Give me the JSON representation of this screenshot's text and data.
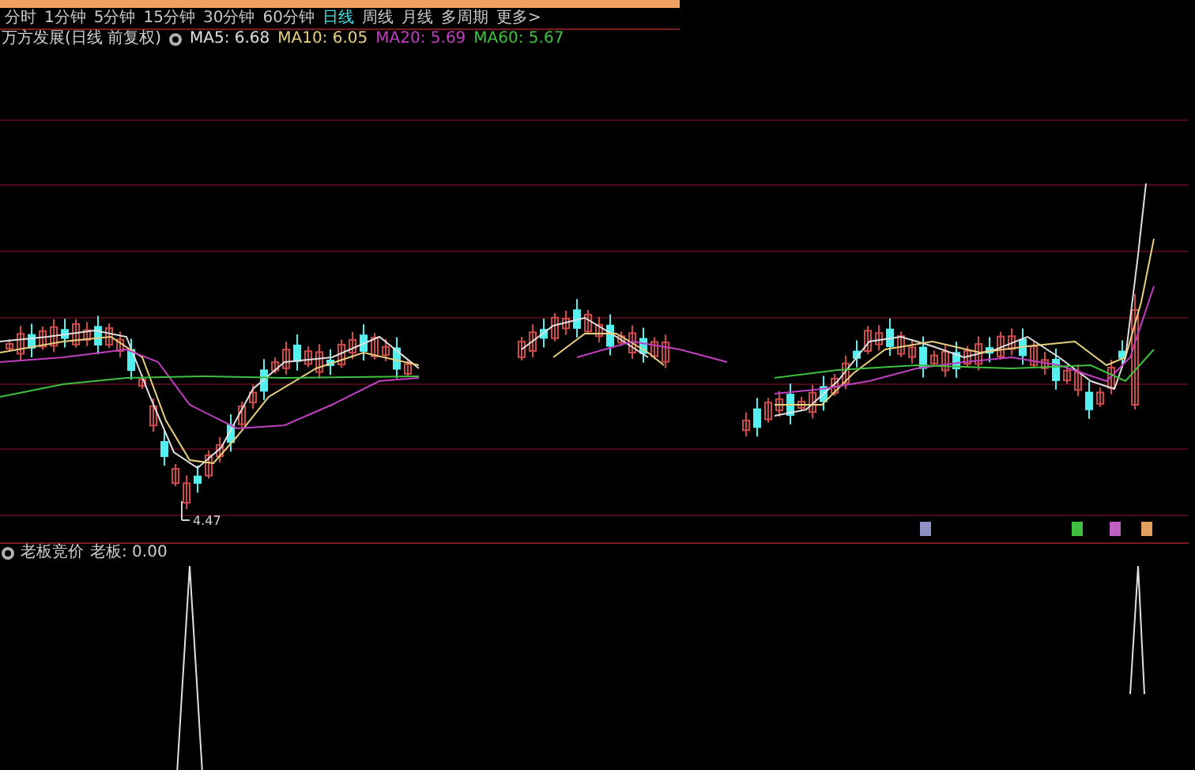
{
  "period_tabs": [
    {
      "label": "分时",
      "selected": false
    },
    {
      "label": "1分钟",
      "selected": false
    },
    {
      "label": "5分钟",
      "selected": false
    },
    {
      "label": "15分钟",
      "selected": false
    },
    {
      "label": "30分钟",
      "selected": false
    },
    {
      "label": "60分钟",
      "selected": false
    },
    {
      "label": "日线",
      "selected": true
    },
    {
      "label": "周线",
      "selected": false
    },
    {
      "label": "月线",
      "selected": false
    },
    {
      "label": "多周期",
      "selected": false
    },
    {
      "label": "更多>",
      "selected": false
    }
  ],
  "legend": {
    "title": "万方发展(日线 前复权)",
    "averages": [
      {
        "label": "MA5: 6.68",
        "color": "#e0e0e0"
      },
      {
        "label": "MA10: 6.05",
        "color": "#e8d080"
      },
      {
        "label": "MA20: 5.69",
        "color": "#c040c0"
      },
      {
        "label": "MA60: 5.67",
        "color": "#40c040"
      }
    ]
  },
  "price_chart": {
    "low_label": "4.47",
    "event_markers": [
      {
        "color": "#9090c8"
      },
      {
        "color": "#40c040"
      },
      {
        "color": "#c060c0"
      },
      {
        "color": "#e0a060"
      }
    ]
  },
  "indicator_panel": {
    "title": "老板竞价",
    "value": "老板: 0.00"
  }
}
